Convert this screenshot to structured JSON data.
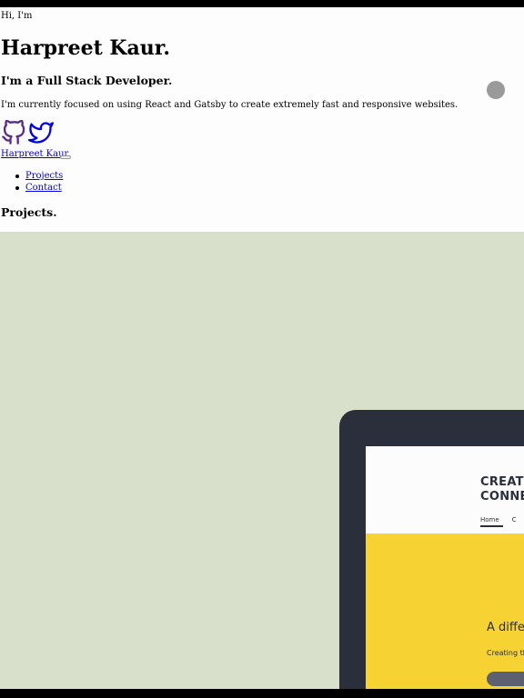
{
  "hero": {
    "greeting": "Hi, I'm",
    "name": "Harpreet Kaur.",
    "role": "I'm a Full Stack Developer.",
    "focus": "I'm currently focused on using React and Gatsby to create extremely fast and responsive websites."
  },
  "social": {
    "icons": [
      "github-icon",
      "twitter-icon"
    ],
    "color": "#5b2a8c"
  },
  "nav": {
    "brand": "Harpreet Kaur",
    "items": [
      "Projects",
      "Contact"
    ]
  },
  "projects": {
    "heading": "Projects.",
    "preview": {
      "background": "#d8dfca",
      "site_title": "CREATI\nCONNE",
      "nav_items": [
        "Home",
        "C"
      ],
      "hero_heading": "A diffe",
      "hero_text": "Creating the world"
    }
  },
  "colors": {
    "link": "#0000ee",
    "device": "#2b2f3c",
    "accent_yellow": "#f6d232",
    "loader": "#9a9a9a"
  }
}
